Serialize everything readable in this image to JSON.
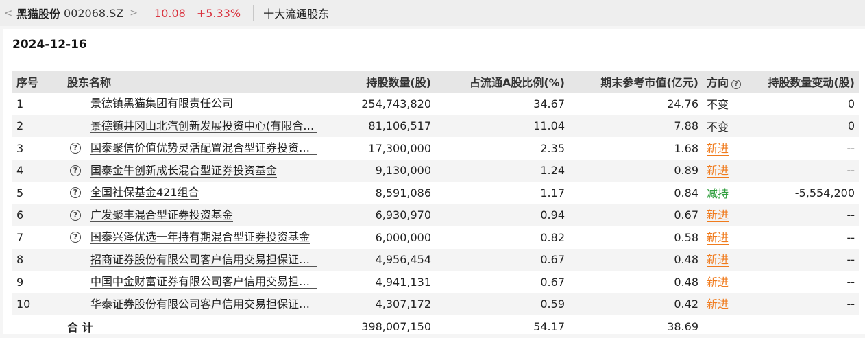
{
  "header": {
    "back_glyph": "<",
    "stock_name": "黑猫股份",
    "stock_code": "002068.SZ",
    "chevron_glyph": ">",
    "price": "10.08",
    "change": "+5.33%",
    "section": "十大流通股东"
  },
  "date": "2024-12-16",
  "table": {
    "columns": [
      "序号",
      "股东名称",
      "持股数量(股)",
      "占流通A股比例(%)",
      "期末参考市值(亿元)",
      "方向",
      "持股数量变动(股)"
    ],
    "rows": [
      {
        "no": "1",
        "icon": false,
        "name": "景德镇黑猫集团有限责任公司",
        "shares": "254,743,820",
        "ratio": "34.67",
        "value": "24.76",
        "direction": "不变",
        "dir_type": "same",
        "change": "0"
      },
      {
        "no": "2",
        "icon": false,
        "name": "景德镇井冈山北汽创新发展投资中心(有限合伙)",
        "shares": "81,106,517",
        "ratio": "11.04",
        "value": "7.88",
        "direction": "不变",
        "dir_type": "same",
        "change": "0"
      },
      {
        "no": "3",
        "icon": true,
        "name": "国泰聚信价值优势灵活配置混合型证券投资基金",
        "shares": "17,300,000",
        "ratio": "2.35",
        "value": "1.68",
        "direction": "新进",
        "dir_type": "new",
        "change": "--"
      },
      {
        "no": "4",
        "icon": true,
        "name": "国泰金牛创新成长混合型证券投资基金",
        "shares": "9,130,000",
        "ratio": "1.24",
        "value": "0.89",
        "direction": "新进",
        "dir_type": "new",
        "change": "--"
      },
      {
        "no": "5",
        "icon": true,
        "name": "全国社保基金421组合",
        "shares": "8,591,086",
        "ratio": "1.17",
        "value": "0.84",
        "direction": "减持",
        "dir_type": "reduce",
        "change": "-5,554,200"
      },
      {
        "no": "6",
        "icon": true,
        "name": "广发聚丰混合型证券投资基金",
        "shares": "6,930,970",
        "ratio": "0.94",
        "value": "0.67",
        "direction": "新进",
        "dir_type": "new",
        "change": "--"
      },
      {
        "no": "7",
        "icon": true,
        "name": "国泰兴泽优选一年持有期混合型证券投资基金",
        "shares": "6,000,000",
        "ratio": "0.82",
        "value": "0.58",
        "direction": "新进",
        "dir_type": "new",
        "change": "--"
      },
      {
        "no": "8",
        "icon": false,
        "name": "招商证券股份有限公司客户信用交易担保证券账户",
        "shares": "4,956,454",
        "ratio": "0.67",
        "value": "0.48",
        "direction": "新进",
        "dir_type": "new",
        "change": "--"
      },
      {
        "no": "9",
        "icon": false,
        "name": "中国中金财富证券有限公司客户信用交易担保证券账户",
        "shares": "4,941,131",
        "ratio": "0.67",
        "value": "0.48",
        "direction": "新进",
        "dir_type": "new",
        "change": "--"
      },
      {
        "no": "10",
        "icon": false,
        "name": "华泰证券股份有限公司客户信用交易担保证券账户",
        "shares": "4,307,172",
        "ratio": "0.59",
        "value": "0.42",
        "direction": "新进",
        "dir_type": "new",
        "change": "--"
      }
    ],
    "total": {
      "label": "合 计",
      "shares": "398,007,150",
      "ratio": "54.17",
      "value": "38.69"
    }
  },
  "icons": {
    "help": "question-circle-icon",
    "back": "chevron-left-icon",
    "forward": "chevron-right-icon"
  },
  "colors": {
    "up": "#d9333f",
    "new": "#f07b1d",
    "reduce": "#2e9e3c"
  }
}
